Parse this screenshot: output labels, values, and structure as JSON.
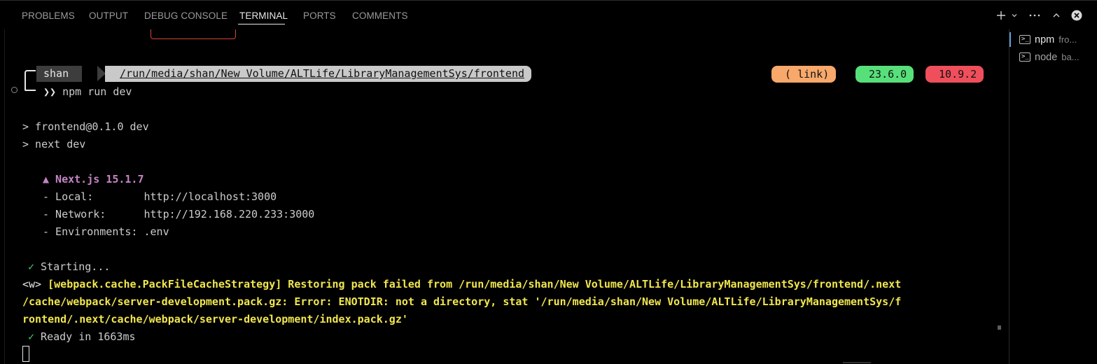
{
  "tabs": [
    {
      "label": "PROBLEMS",
      "active": false
    },
    {
      "label": "OUTPUT",
      "active": false
    },
    {
      "label": "DEBUG CONSOLE",
      "active": false
    },
    {
      "label": "TERMINAL",
      "active": true
    },
    {
      "label": "PORTS",
      "active": false
    },
    {
      "label": "COMMENTS",
      "active": false
    }
  ],
  "toolbar": {
    "add_label": "+",
    "dropdown_label": "⌄",
    "more_label": "···",
    "icons": [
      "plus-icon",
      "chevron-down-icon",
      "ellipsis-icon",
      "chevron-up-icon",
      "close-icon"
    ]
  },
  "prompt": {
    "user": "shan ",
    "user_glyph": "",
    "path_glyph": "",
    "path": "/run/media/shan/New Volume/ALTLife/LibraryManagementSys/frontend",
    "command_arrow": "❯❯",
    "command": "npm run dev"
  },
  "badges": {
    "git": {
      "text": " ( link)",
      "color": "#f7a86a"
    },
    "node": {
      "text": " 23.6.0",
      "color": "#57e07a"
    },
    "npm": {
      "text": " 10.9.2",
      "color": "#ef4f5b"
    }
  },
  "output": {
    "script_line1": "> frontend@0.1.0 dev",
    "script_line2": "> next dev",
    "nextjs_label": "▲ Next.js 15.1.7",
    "local_label": "- Local:        http://localhost:3000",
    "network_label": "- Network:      http://192.168.220.233:3000",
    "env_label": "- Environments: .env",
    "check_mark": "✓",
    "starting": " Starting...",
    "warn_tag": "<w>",
    "warn_line1": " [webpack.cache.PackFileCacheStrategy] Restoring pack failed from /run/media/shan/New Volume/ALTLife/LibraryManagementSys/frontend/.next",
    "warn_line2": "/cache/webpack/server-development.pack.gz: Error: ENOTDIR: not a directory, stat '/run/media/shan/New Volume/ALTLife/LibraryManagementSys/f",
    "warn_line3": "rontend/.next/cache/webpack/server-development/index.pack.gz'",
    "ready": " Ready in 1663ms"
  },
  "terminals": [
    {
      "name": "npm",
      "subtitle": "fro...",
      "selected": true
    },
    {
      "name": "node",
      "subtitle": "ba...",
      "selected": false
    }
  ],
  "colors": {
    "background": "#000000",
    "tab_active": "#e7e7e7",
    "tab_inactive": "#9a9a9a",
    "nextjs": "#c585c5",
    "check": "#3ccf6e",
    "warning": "#f1e64f"
  }
}
